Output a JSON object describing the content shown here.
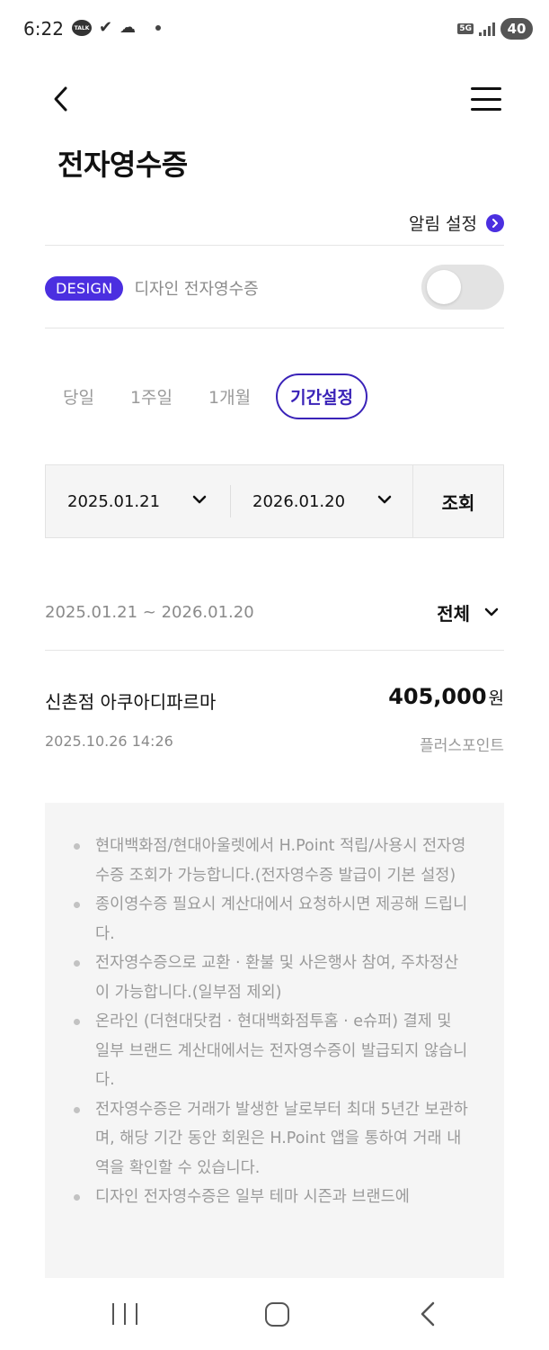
{
  "status_bar": {
    "time": "6:22",
    "talk_badge": "TALK",
    "network": "5G",
    "battery": "40"
  },
  "header": {
    "title": "전자영수증",
    "back_icon": "chevron-left-icon",
    "menu_icon": "hamburger-menu-icon"
  },
  "alarm": {
    "label": "알림 설정"
  },
  "design": {
    "badge": "DESIGN",
    "label": "디자인 전자영수증",
    "toggle_on": false
  },
  "periods": {
    "tabs": [
      "당일",
      "1주일",
      "1개월",
      "기간설정"
    ],
    "active": "기간설정"
  },
  "date_range": {
    "start": "2025.01.21",
    "end": "2026.01.20",
    "search_label": "조회"
  },
  "results": {
    "range_text": "2025.01.21 ~ 2026.01.20",
    "filter_label": "전체"
  },
  "receipts": [
    {
      "store": "신촌점 아쿠아디파르마",
      "amount": "405,000",
      "unit": "원",
      "datetime": "2025.10.26 14:26",
      "payment": "플러스포인트"
    }
  ],
  "notice": {
    "items": [
      "현대백화점/현대아울렛에서 H.Point 적립/사용시 전자영수증 조회가 가능합니다.(전자영수증 발급이 기본 설정)",
      "종이영수증 필요시 계산대에서 요청하시면 제공해 드립니다.",
      "전자영수증으로 교환 · 환불 및 사은행사 참여, 주차정산이 가능합니다.(일부점 제외)",
      "온라인 (더현대닷컴 · 현대백화점투홈 · e슈퍼) 결제 및 일부 브랜드 계산대에서는 전자영수증이 발급되지 않습니다.",
      "전자영수증은 거래가 발생한 날로부터 최대 5년간 보관하며, 해당 기간 동안 회원은 H.Point 앱을 통하여 거래 내역을 확인할 수 있습니다.",
      "디자인 전자영수증은 일부 테마 시즌과 브랜드에"
    ]
  },
  "colors": {
    "accent": "#4b2fe0",
    "active_tab": "#3a23b8",
    "muted_text": "#8a8a8a",
    "panel_bg": "#f5f5f5"
  }
}
